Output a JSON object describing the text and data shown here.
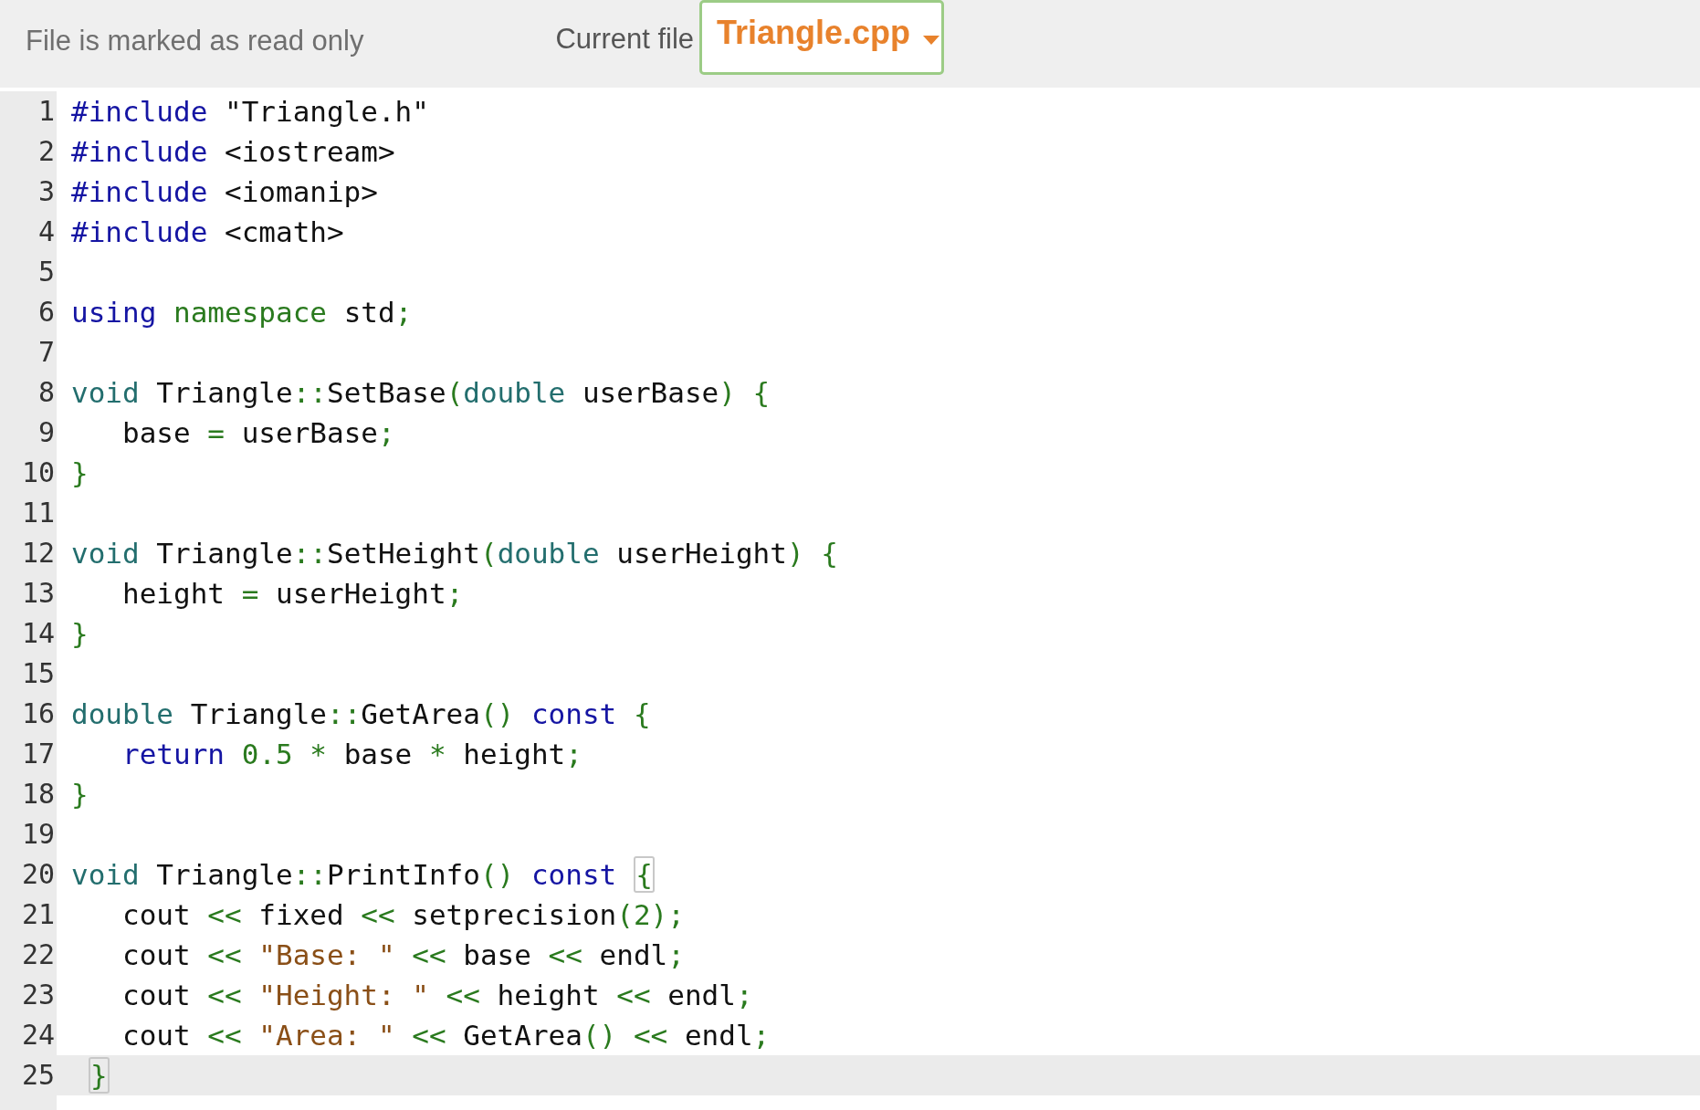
{
  "toolbar": {
    "read_only_notice": "File is marked as read only",
    "file_label": "Current file",
    "file_select": {
      "value": "Triangle.cpp"
    }
  },
  "editor": {
    "lines": [
      {
        "number": "1",
        "active": false,
        "tokens": [
          {
            "kind": "keyword",
            "text": "#include"
          },
          {
            "kind": "plain",
            "text": " \"Triangle.h\""
          }
        ]
      },
      {
        "number": "2",
        "active": false,
        "tokens": [
          {
            "kind": "keyword",
            "text": "#include"
          },
          {
            "kind": "plain",
            "text": " <iostream>"
          }
        ]
      },
      {
        "number": "3",
        "active": false,
        "tokens": [
          {
            "kind": "keyword",
            "text": "#include"
          },
          {
            "kind": "plain",
            "text": " <iomanip>"
          }
        ]
      },
      {
        "number": "4",
        "active": false,
        "tokens": [
          {
            "kind": "keyword",
            "text": "#include"
          },
          {
            "kind": "plain",
            "text": " <cmath>"
          }
        ]
      },
      {
        "number": "5",
        "active": false
      },
      {
        "number": "6",
        "active": false,
        "tokens": [
          {
            "kind": "keyword",
            "text": "using"
          },
          {
            "kind": "namespace",
            "text": " namespace"
          },
          {
            "kind": "plain",
            "text": " std"
          },
          {
            "kind": "operator",
            "text": ";"
          }
        ]
      },
      {
        "number": "7",
        "active": false
      },
      {
        "number": "8",
        "active": false,
        "tokens": [
          {
            "kind": "type",
            "text": "void"
          },
          {
            "kind": "plain",
            "text": " Triangle"
          },
          {
            "kind": "operator",
            "text": "::"
          },
          {
            "kind": "plain",
            "text": "SetBase"
          },
          {
            "kind": "operator",
            "text": "("
          },
          {
            "kind": "type",
            "text": "double"
          },
          {
            "kind": "plain",
            "text": " userBase"
          },
          {
            "kind": "operator",
            "text": ")"
          },
          {
            "kind": "operator",
            "text": " {"
          }
        ]
      },
      {
        "number": "9",
        "active": false,
        "tokens": [
          {
            "kind": "plain",
            "text": "   base "
          },
          {
            "kind": "operator",
            "text": "="
          },
          {
            "kind": "plain",
            "text": " userBase"
          },
          {
            "kind": "operator",
            "text": ";"
          }
        ]
      },
      {
        "number": "10",
        "active": false,
        "tokens": [
          {
            "kind": "operator",
            "text": "}"
          }
        ]
      },
      {
        "number": "11",
        "active": false
      },
      {
        "number": "12",
        "active": false,
        "tokens": [
          {
            "kind": "type",
            "text": "void"
          },
          {
            "kind": "plain",
            "text": " Triangle"
          },
          {
            "kind": "operator",
            "text": "::"
          },
          {
            "kind": "plain",
            "text": "SetHeight"
          },
          {
            "kind": "operator",
            "text": "("
          },
          {
            "kind": "type",
            "text": "double"
          },
          {
            "kind": "plain",
            "text": " userHeight"
          },
          {
            "kind": "operator",
            "text": ")"
          },
          {
            "kind": "operator",
            "text": " {"
          }
        ]
      },
      {
        "number": "13",
        "active": false,
        "tokens": [
          {
            "kind": "plain",
            "text": "   height "
          },
          {
            "kind": "operator",
            "text": "="
          },
          {
            "kind": "plain",
            "text": " userHeight"
          },
          {
            "kind": "operator",
            "text": ";"
          }
        ]
      },
      {
        "number": "14",
        "active": false,
        "tokens": [
          {
            "kind": "operator",
            "text": "}"
          }
        ]
      },
      {
        "number": "15",
        "active": false
      },
      {
        "number": "16",
        "active": false,
        "tokens": [
          {
            "kind": "type",
            "text": "double"
          },
          {
            "kind": "plain",
            "text": " Triangle"
          },
          {
            "kind": "operator",
            "text": "::"
          },
          {
            "kind": "plain",
            "text": "GetArea"
          },
          {
            "kind": "operator",
            "text": "()"
          },
          {
            "kind": "keyword",
            "text": " const"
          },
          {
            "kind": "operator",
            "text": " {"
          }
        ]
      },
      {
        "number": "17",
        "active": false,
        "tokens": [
          {
            "kind": "keyword",
            "text": "   return"
          },
          {
            "kind": "number",
            "text": " 0.5"
          },
          {
            "kind": "operator",
            "text": " *"
          },
          {
            "kind": "plain",
            "text": " base "
          },
          {
            "kind": "operator",
            "text": "*"
          },
          {
            "kind": "plain",
            "text": " height"
          },
          {
            "kind": "operator",
            "text": ";"
          }
        ]
      },
      {
        "number": "18",
        "active": false,
        "tokens": [
          {
            "kind": "operator",
            "text": "}"
          }
        ]
      },
      {
        "number": "19",
        "active": false
      },
      {
        "number": "20",
        "active": false,
        "tokens": [
          {
            "kind": "type",
            "text": "void"
          },
          {
            "kind": "plain",
            "text": " Triangle"
          },
          {
            "kind": "operator",
            "text": "::"
          },
          {
            "kind": "plain",
            "text": "PrintInfo"
          },
          {
            "kind": "operator",
            "text": "()"
          },
          {
            "kind": "keyword",
            "text": " const"
          },
          {
            "kind": "matched_bracket",
            "text": "{"
          }
        ]
      },
      {
        "number": "21",
        "active": false,
        "tokens": [
          {
            "kind": "plain",
            "text": "   cout "
          },
          {
            "kind": "operator",
            "text": "<<"
          },
          {
            "kind": "plain",
            "text": " fixed "
          },
          {
            "kind": "operator",
            "text": "<<"
          },
          {
            "kind": "plain",
            "text": " setprecision"
          },
          {
            "kind": "operator",
            "text": "("
          },
          {
            "kind": "number",
            "text": "2"
          },
          {
            "kind": "operator",
            "text": ");"
          }
        ]
      },
      {
        "number": "22",
        "active": false,
        "tokens": [
          {
            "kind": "plain",
            "text": "   cout "
          },
          {
            "kind": "operator",
            "text": "<<"
          },
          {
            "kind": "string",
            "text": " \"Base: \""
          },
          {
            "kind": "operator",
            "text": " <<"
          },
          {
            "kind": "plain",
            "text": " base "
          },
          {
            "kind": "operator",
            "text": "<<"
          },
          {
            "kind": "plain",
            "text": " endl"
          },
          {
            "kind": "operator",
            "text": ";"
          }
        ]
      },
      {
        "number": "23",
        "active": false,
        "tokens": [
          {
            "kind": "plain",
            "text": "   cout "
          },
          {
            "kind": "operator",
            "text": "<<"
          },
          {
            "kind": "string",
            "text": " \"Height: \""
          },
          {
            "kind": "operator",
            "text": " <<"
          },
          {
            "kind": "plain",
            "text": " height "
          },
          {
            "kind": "operator",
            "text": "<<"
          },
          {
            "kind": "plain",
            "text": " endl"
          },
          {
            "kind": "operator",
            "text": ";"
          }
        ]
      },
      {
        "number": "24",
        "active": false,
        "tokens": [
          {
            "kind": "plain",
            "text": "   cout "
          },
          {
            "kind": "operator",
            "text": "<<"
          },
          {
            "kind": "string",
            "text": " \"Area: \""
          },
          {
            "kind": "operator",
            "text": " <<"
          },
          {
            "kind": "plain",
            "text": " GetArea"
          },
          {
            "kind": "operator",
            "text": "()"
          },
          {
            "kind": "operator",
            "text": " <<"
          },
          {
            "kind": "plain",
            "text": " endl"
          },
          {
            "kind": "operator",
            "text": ";"
          }
        ]
      },
      {
        "number": "25",
        "active": true,
        "tokens": [
          {
            "kind": "matched_bracket",
            "text": "}"
          }
        ]
      }
    ]
  }
}
